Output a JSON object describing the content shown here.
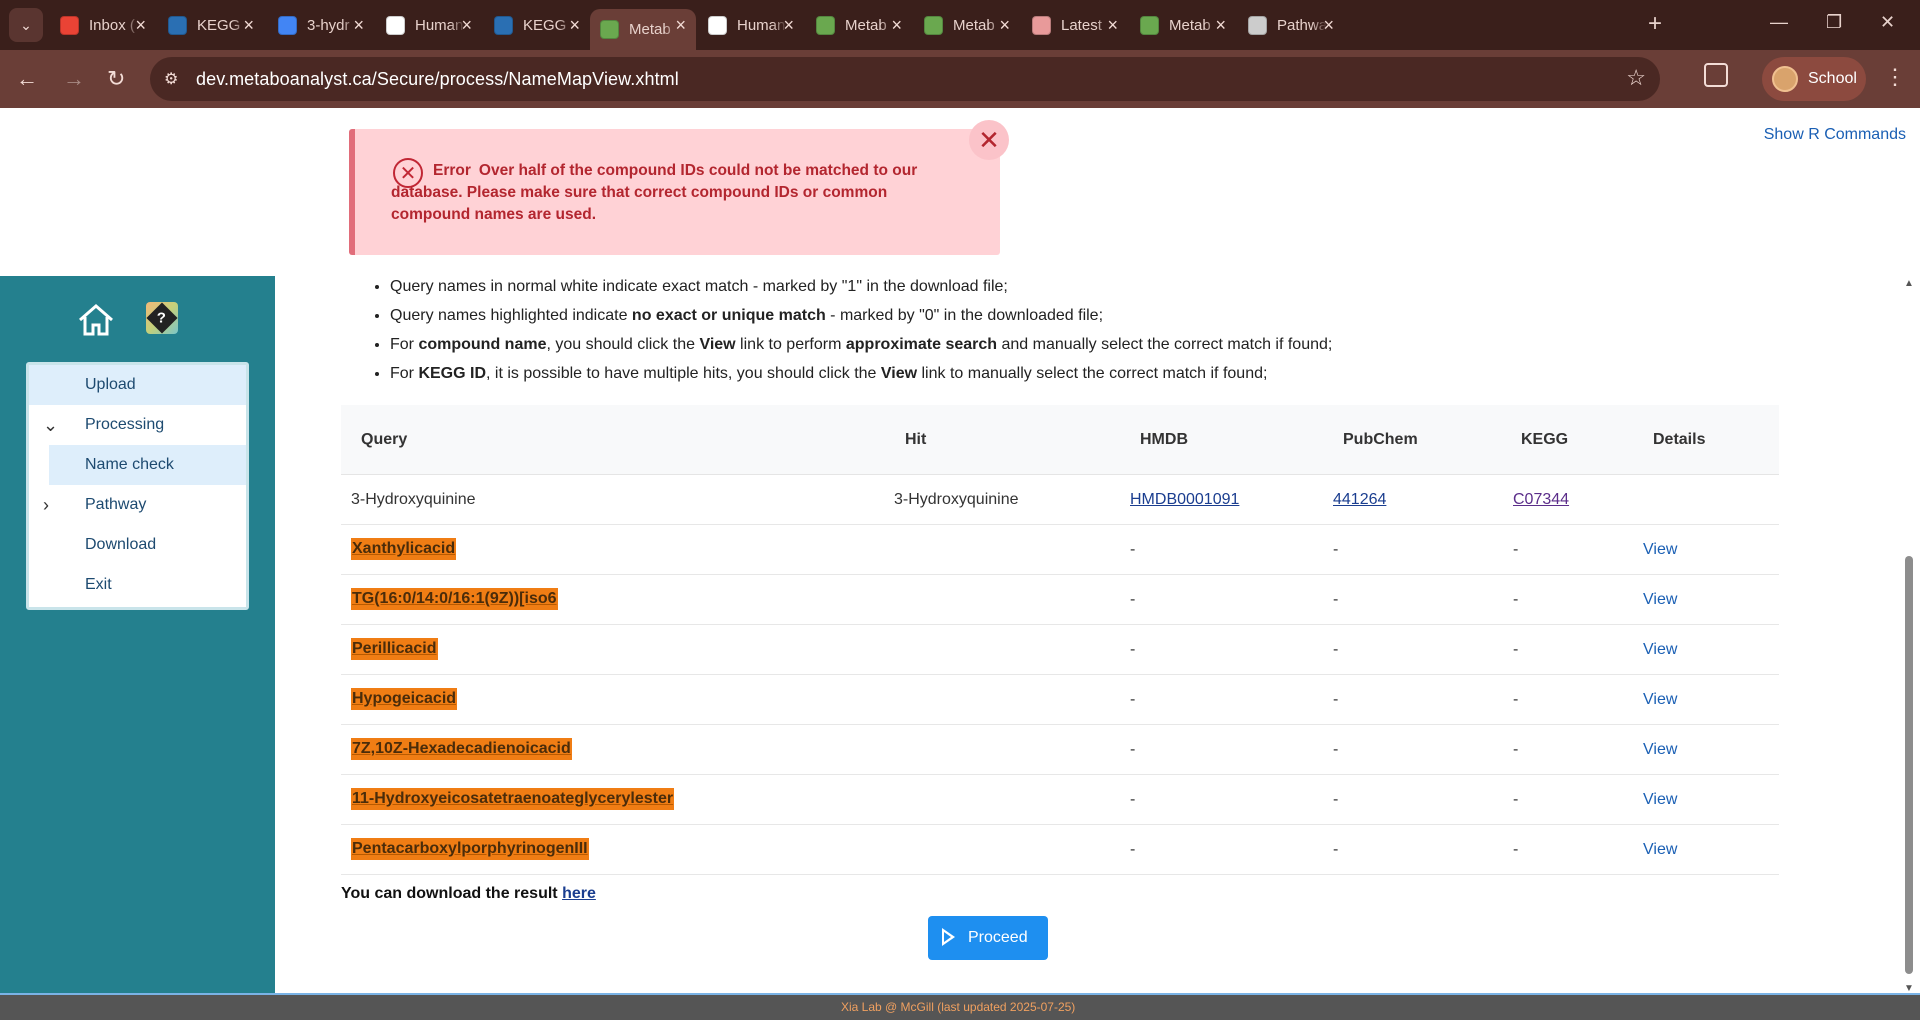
{
  "browser": {
    "tabs": [
      {
        "title": "Inbox (",
        "icon": "gmail-icon",
        "color": "#ea4335"
      },
      {
        "title": "KEGG (",
        "icon": "kegg-icon",
        "color": "#2a6fb3"
      },
      {
        "title": "3-hydr",
        "icon": "google-icon",
        "color": "#4285f4"
      },
      {
        "title": "Human",
        "icon": "hmp-icon",
        "color": "#ffffff"
      },
      {
        "title": "KEGG (",
        "icon": "kegg-icon",
        "color": "#2a6fb3"
      },
      {
        "title": "Metab",
        "icon": "metaboanalyst-icon",
        "color": "#6aa84f"
      },
      {
        "title": "Human",
        "icon": "hmp-icon",
        "color": "#ffffff"
      },
      {
        "title": "Metab",
        "icon": "metaboanalyst-icon",
        "color": "#6aa84f"
      },
      {
        "title": "Metab",
        "icon": "metaboanalyst-icon",
        "color": "#6aa84f"
      },
      {
        "title": "Latest",
        "icon": "latest-icon",
        "color": "#e89a9a"
      },
      {
        "title": "Metab",
        "icon": "metaboanalyst-icon",
        "color": "#6aa84f"
      },
      {
        "title": "Pathwa",
        "icon": "openai-icon",
        "color": "#cccccc"
      }
    ],
    "active_tab_index": 5,
    "url": "dev.metaboanalyst.ca/Secure/process/NameMapView.xhtml",
    "profile_name": "School"
  },
  "page": {
    "show_r_commands": "Show R Commands",
    "error": {
      "title": "Error",
      "message": "Over half of the compound IDs could not be matched to our database. Please make sure that correct compound IDs or common compound names are used."
    },
    "sidebar": {
      "items": [
        {
          "label": "Upload"
        },
        {
          "label": "Processing"
        },
        {
          "label": "Name check"
        },
        {
          "label": "Pathway"
        },
        {
          "label": "Download"
        },
        {
          "label": "Exit"
        }
      ]
    },
    "bullets": [
      {
        "a": "Query names in normal white indicate exact match - marked by \"1\" in the download file;"
      },
      {
        "a": "Query names highlighted indicate ",
        "b": "no exact or unique match",
        "c": " - marked by \"0\" in the downloaded file;"
      },
      {
        "a": "For ",
        "b": "compound name",
        "c": ", you should click the ",
        "d": "View",
        "e": " link to perform ",
        "f": "approximate search",
        "g": " and manually select the correct match if found;"
      },
      {
        "a": "For ",
        "b": "KEGG ID",
        "c": ", it is possible to have multiple hits, you should click the ",
        "d": "View",
        "e": " link to manually select the correct match if found;"
      }
    ],
    "table": {
      "headers": [
        "Query",
        "Hit",
        "HMDB",
        "PubChem",
        "KEGG",
        "Details"
      ],
      "rows": [
        {
          "query": "3-Hydroxyquinine",
          "hit": "3-Hydroxyquinine",
          "hmdb": "HMDB0001091",
          "pubchem": "441264",
          "kegg": "C07344",
          "details": ""
        },
        {
          "query": "Xanthylicacid",
          "hit": "",
          "hmdb": "-",
          "pubchem": "-",
          "kegg": "-",
          "details": "View"
        },
        {
          "query": "TG(16:0/14:0/16:1(9Z))[iso6",
          "hit": "",
          "hmdb": "-",
          "pubchem": "-",
          "kegg": "-",
          "details": "View"
        },
        {
          "query": "Perillicacid",
          "hit": "",
          "hmdb": "-",
          "pubchem": "-",
          "kegg": "-",
          "details": "View"
        },
        {
          "query": "Hypogeicacid",
          "hit": "",
          "hmdb": "-",
          "pubchem": "-",
          "kegg": "-",
          "details": "View"
        },
        {
          "query": "7Z,10Z-Hexadecadienoicacid",
          "hit": "",
          "hmdb": "-",
          "pubchem": "-",
          "kegg": "-",
          "details": "View"
        },
        {
          "query": "11-Hydroxyeicosatetraenoateglycerylester",
          "hit": "",
          "hmdb": "-",
          "pubchem": "-",
          "kegg": "-",
          "details": "View"
        },
        {
          "query": "PentacarboxylporphyrinogenIII",
          "hit": "",
          "hmdb": "-",
          "pubchem": "-",
          "kegg": "-",
          "details": "View"
        }
      ]
    },
    "download_text": "You can download the result ",
    "download_link": "here",
    "proceed_label": "Proceed",
    "footer": "Xia Lab @ McGill   (last updated 2025-07-25)"
  }
}
